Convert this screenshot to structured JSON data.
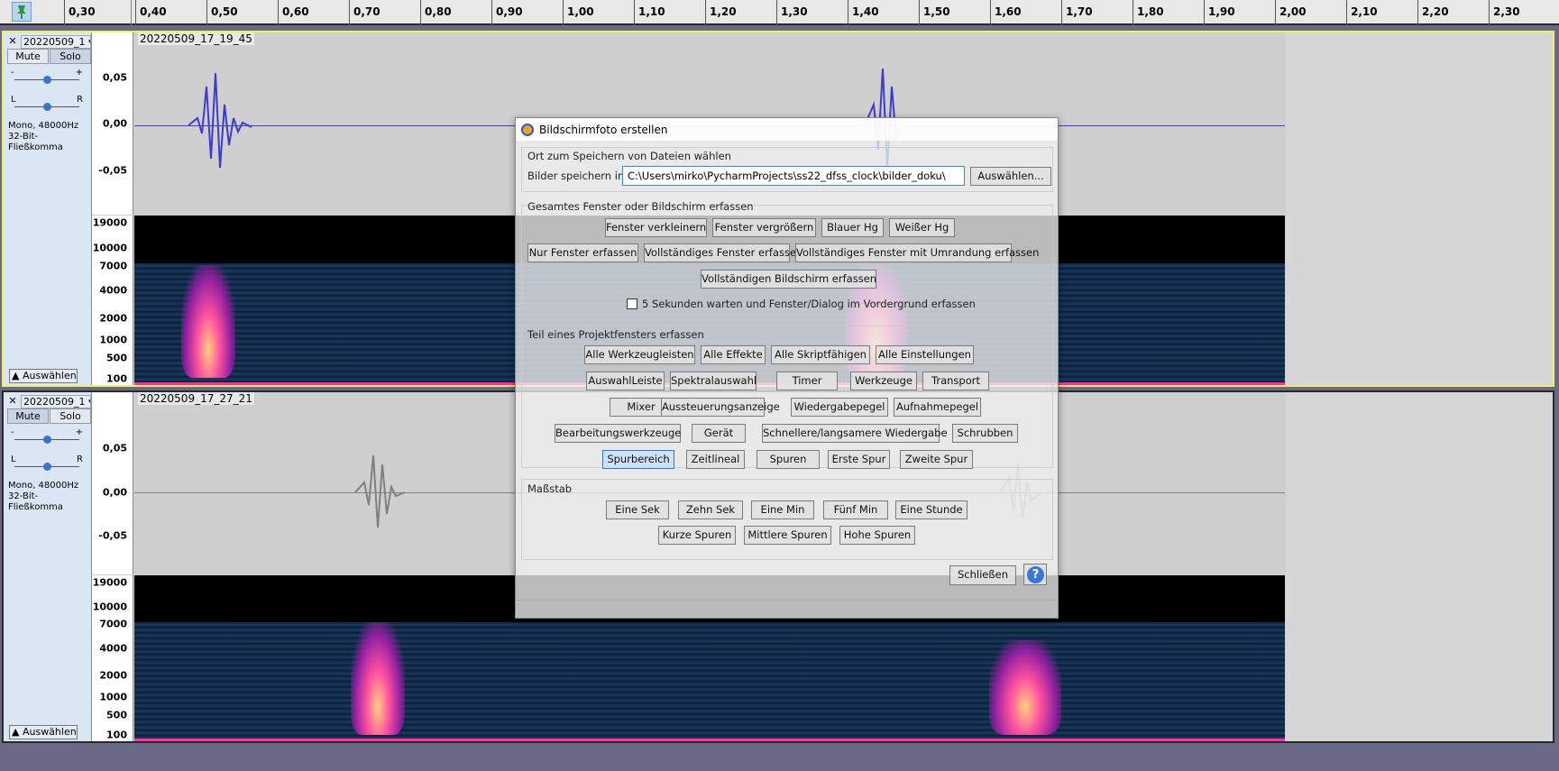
{
  "ruler": {
    "ticks": [
      "0,30",
      "0,40",
      "0,50",
      "0,60",
      "0,70",
      "0,80",
      "0,90",
      "1,00",
      "1,10",
      "1,20",
      "1,30",
      "1,40",
      "1,50",
      "1,60",
      "1,70",
      "1,80",
      "1,90",
      "2,00",
      "2,10",
      "2,20",
      "2,30"
    ]
  },
  "tracks": [
    {
      "name": "20220509_1",
      "clip_label": "20220509_17_19_45",
      "mute": "Mute",
      "solo": "Solo",
      "gain_minus": "-",
      "gain_plus": "+",
      "pan_l": "L",
      "pan_r": "R",
      "info1": "Mono, 48000Hz",
      "info2": "32-Bit-Fließkomma",
      "select": "Auswählen",
      "wave_scale": [
        "0,05",
        "0,00",
        "-0,05"
      ],
      "spec_scale": [
        "19000",
        "10000",
        "7000",
        "4000",
        "2000",
        "1000",
        "500",
        "100"
      ],
      "wave_color": "#3c3cd0"
    },
    {
      "name": "20220509_1",
      "clip_label": "20220509_17_27_21",
      "mute": "Mute",
      "solo": "Solo",
      "gain_minus": "-",
      "gain_plus": "+",
      "pan_l": "L",
      "pan_r": "R",
      "info1": "Mono, 48000Hz",
      "info2": "32-Bit-Fließkomma",
      "select": "Auswählen",
      "wave_scale": [
        "0,05",
        "0,00",
        "-0,05"
      ],
      "spec_scale": [
        "19000",
        "10000",
        "7000",
        "4000",
        "2000",
        "1000",
        "500",
        "100"
      ],
      "wave_color": "#808080"
    }
  ],
  "dialog": {
    "title": "Bildschirmfoto erstellen",
    "save_group": "Ort zum Speichern von Dateien wählen",
    "save_label": "Bilder speichern in:",
    "save_path": "C:\\Users\\mirko\\PycharmProjects\\ss22_dfss_clock\\bilder_doku\\",
    "browse": "Auswählen...",
    "whole_group": "Gesamtes Fenster oder Bildschirm erfassen",
    "whole_buttons": [
      "Fenster verkleinern",
      "Fenster vergrößern",
      "Blauer Hg",
      "Weißer Hg",
      "Nur Fenster erfassen",
      "Vollständiges Fenster erfassen",
      "Vollständiges Fenster mit Umrandung erfassen",
      "Vollständigen Bildschirm erfassen"
    ],
    "delay_label": "5 Sekunden warten und Fenster/Dialog im Vordergrund erfassen",
    "part_group": "Teil eines Projektfensters erfassen",
    "part_buttons": [
      "Alle Werkzeugleisten",
      "Alle Effekte",
      "Alle Skriptfähigen",
      "Alle Einstellungen",
      "AuswahlLeiste",
      "Spektralauswahl",
      "Timer",
      "Werkzeuge",
      "Transport",
      "Mixer",
      "Aussteuerungsanzeige",
      "Wiedergabepegel",
      "Aufnahmepegel",
      "Bearbeitungswerkzeuge",
      "Gerät",
      "Schnellere/langsamere Wiedergabe",
      "Schrubben",
      "Spurbereich",
      "Zeitlineal",
      "Spuren",
      "Erste Spur",
      "Zweite Spur"
    ],
    "scale_group": "Maßstab",
    "scale_buttons": [
      "Eine Sek",
      "Zehn Sek",
      "Eine Min",
      "Fünf Min",
      "Eine Stunde",
      "Kurze Spuren",
      "Mittlere Spuren",
      "Hohe Spuren"
    ],
    "close": "Schließen",
    "help": "?"
  },
  "colors": {
    "accent": "#2a78d0",
    "selection_border": "#f0f060",
    "background": "#6a6a86"
  }
}
